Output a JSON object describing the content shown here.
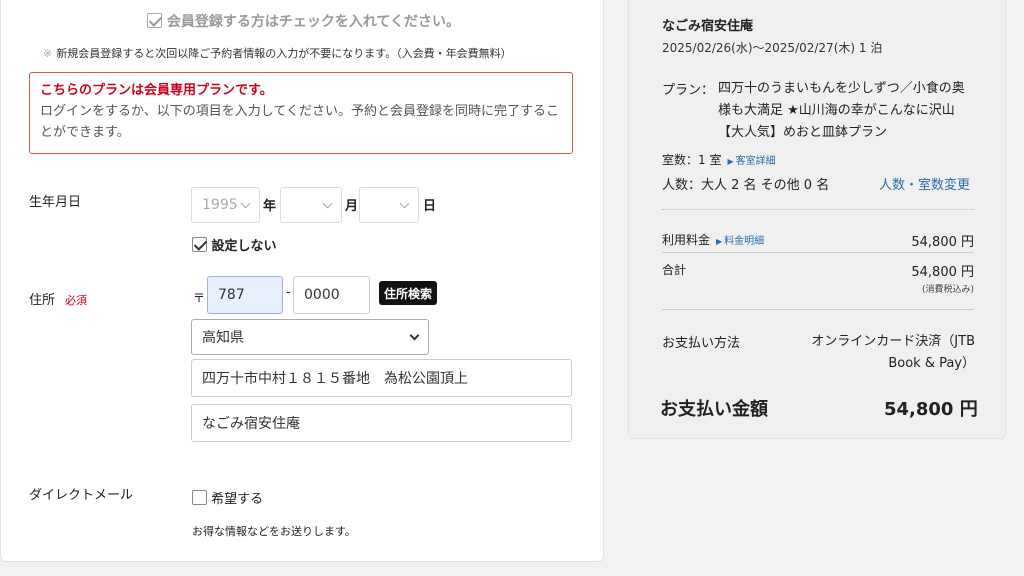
{
  "form": {
    "member_check_label": "会員登録する方はチェックを入れてください。",
    "member_check_checked": true,
    "member_note_mark": "※",
    "member_note": "新規会員登録すると次回以降ご予約者情報の入力が不要になります。（入会費・年会費無料）",
    "alert_title": "こちらのプランは会員専用プランです。",
    "alert_body": "ログインをするか、以下の項目を入力してください。予約と会員登録を同時に完了することができます。",
    "birth": {
      "label": "生年月日",
      "year_value": "1995",
      "month_value": "",
      "day_value": "",
      "year_unit": "年",
      "month_unit": "月",
      "day_unit": "日",
      "no_set_label": "設定しない",
      "no_set_checked": true
    },
    "address": {
      "label": "住所",
      "required": "必須",
      "postal_mark": "〒",
      "postal1": "787",
      "postal_sep": "-",
      "postal2": "0000",
      "search_button": "住所検索",
      "prefecture": "高知県",
      "line1": "四万十市中村１８１５番地　為松公園頂上",
      "line2": "なごみ宿安住庵"
    },
    "dm": {
      "label": "ダイレクトメール",
      "checkbox_label": "希望する",
      "checked": false,
      "note": "お得な情報などをお送りします。"
    }
  },
  "summary": {
    "hotel_name": "なごみ宿安住庵",
    "dates": "2025/02/26(水)〜2025/02/27(木) 1 泊",
    "plan_label": "プラン：",
    "plan_text": "四万十のうまいもんを少しずつ／小食の奥様も大満足 ★山川海の幸がこんなに沢山【大人気】めおと皿鉢プラン",
    "rooms": "室数：1 室",
    "room_detail_link": "客室詳細",
    "people": "人数：大人 2 名 その他 0 名",
    "change_link": "人数・室数変更",
    "fee_label": "利用料金",
    "fee_detail_link": "料金明細",
    "fee_value": "54,800 円",
    "total_label": "合計",
    "total_value": "54,800 円",
    "tax_note": "(消費税込み)",
    "payment_label": "お支払い方法",
    "payment_value": "オンラインカード決済（JTB Book & Pay）",
    "amount_label": "お支払い金額",
    "amount_value": "54,800 円"
  },
  "colors": {
    "accent_red": "#d0021b",
    "link_blue": "#2b6cb0",
    "autofill_blue": "#e8f0fe"
  }
}
